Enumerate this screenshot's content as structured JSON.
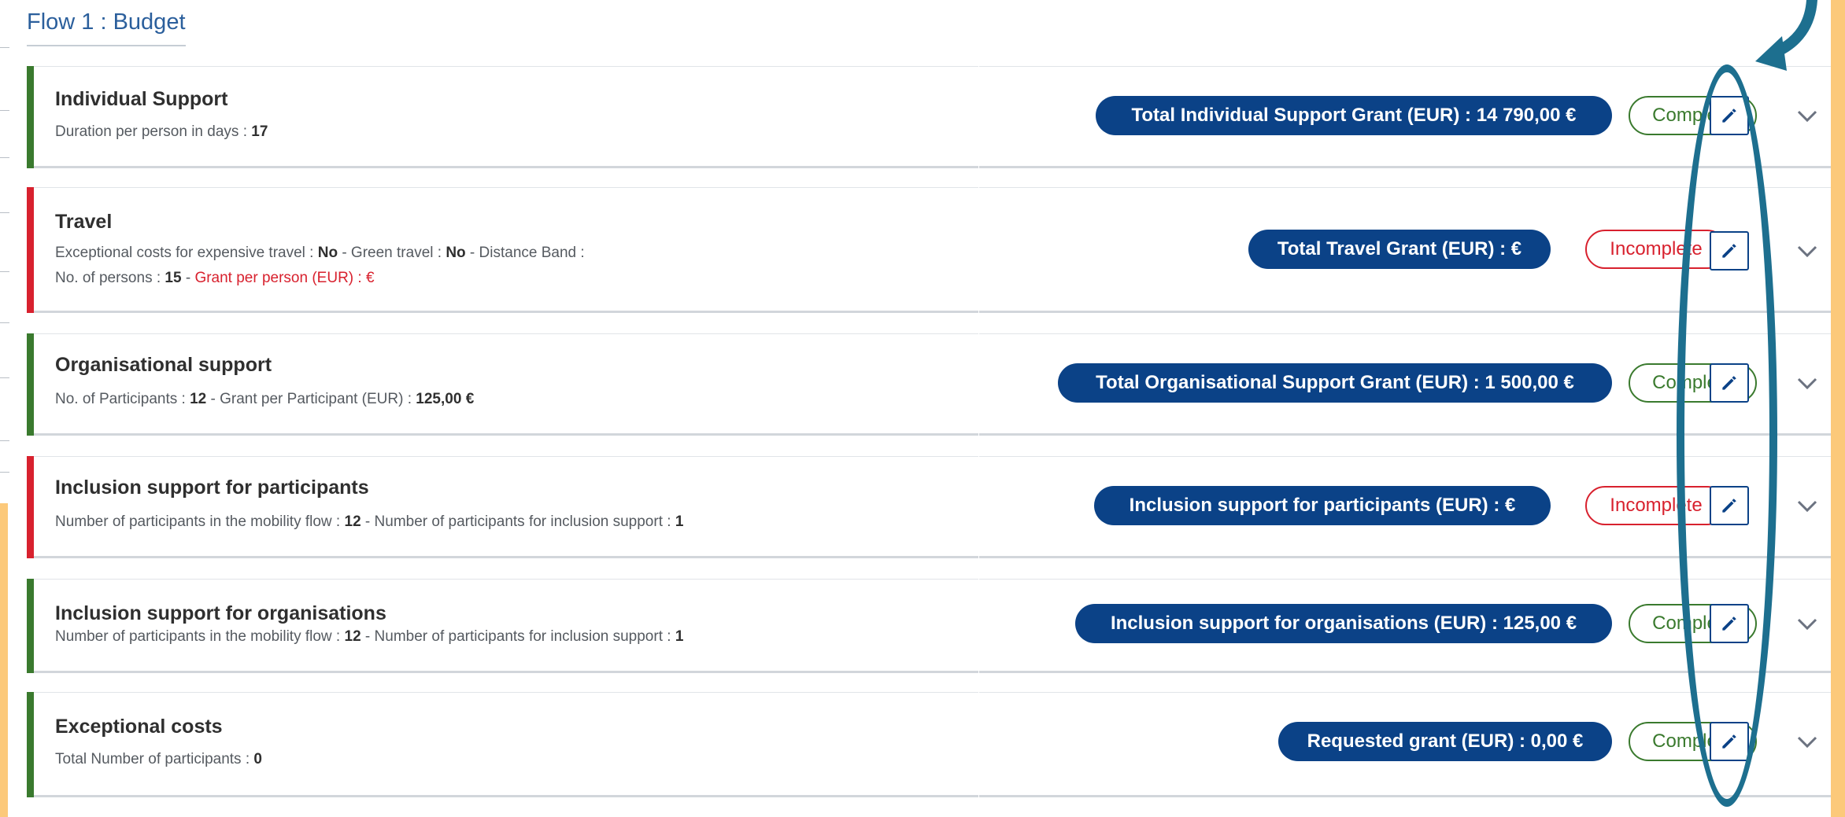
{
  "flow_title": "Flow 1 : Budget",
  "colors": {
    "pill_bg": "#0b4287",
    "complete": "#3a7a2e",
    "incomplete": "#d8212e",
    "annotation": "#1d6f8f",
    "accent_yellow": "#fcc97a"
  },
  "icons": {
    "edit": "pencil-icon",
    "expand": "chevron-down-icon"
  },
  "rows": [
    {
      "title": "Individual Support",
      "detail_1a": "Duration per person in days : ",
      "detail_1b": "17",
      "pill": "Total Individual Support Grant (EUR) : 14 790,00 €",
      "status": "Complete"
    },
    {
      "title": "Travel",
      "detail_1a": "Exceptional costs for expensive travel : ",
      "detail_1b": "No",
      "detail_1c": " - Green travel : ",
      "detail_1d": "No",
      "detail_1e": " - Distance Band :",
      "detail_2a": "No. of persons : ",
      "detail_2b": "15",
      "detail_2c": " - ",
      "detail_2d": "Grant per person (EUR) : €",
      "pill": "Total Travel Grant (EUR) : €",
      "status": "Incomplete"
    },
    {
      "title": "Organisational support",
      "detail_1a": "No. of Participants : ",
      "detail_1b": "12",
      "detail_1c": " - Grant per Participant (EUR) : ",
      "detail_1d": "125,00 €",
      "pill": "Total Organisational Support Grant (EUR) : 1 500,00 €",
      "status": "Complete"
    },
    {
      "title": "Inclusion support for participants",
      "detail_1a": "Number of participants in the mobility flow : ",
      "detail_1b": "12",
      "detail_1c": " - Number of participants for inclusion support : ",
      "detail_1d": "1",
      "pill": "Inclusion support for participants (EUR) : €",
      "status": "Incomplete"
    },
    {
      "title": "Inclusion support for organisations",
      "detail_1a": "Number of participants in the mobility flow : ",
      "detail_1b": "12",
      "detail_1c": " - Number of participants for inclusion support : ",
      "detail_1d": "1",
      "pill": "Inclusion support for organisations (EUR) : 125,00 €",
      "status": "Complete"
    },
    {
      "title": "Exceptional costs",
      "detail_1a": "Total Number of participants : ",
      "detail_1b": "0",
      "pill": "Requested grant (EUR) : 0,00 €",
      "status": "Complete"
    }
  ]
}
